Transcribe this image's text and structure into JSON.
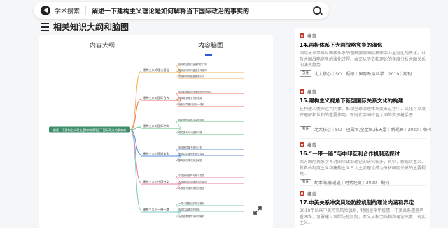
{
  "search": {
    "scope": "学术搜索",
    "query": "阐述一下建构主义理论是如何解释当下国际政治的事实的"
  },
  "section": {
    "title": "相关知识大纲和脑图"
  },
  "tabs": [
    {
      "label": "内容大纲"
    },
    {
      "label": "内容脑图"
    }
  ],
  "mindmap": {
    "root": "阐述一下建构主义理论是如何解释当下国际政治的事实的",
    "branches": [
      {
        "label": "建构主义的理论基础",
        "children": [
          "国际政治是社会建构的产物",
          "国家身份和利益由互动建构",
          "观念和规范塑造国家行为"
        ]
      },
      {
        "label": "建构主义对国际合作",
        "children": [
          "国际制度促进国家间合作的形成",
          "共享观念是合作的基础",
          "身份认同推动区域一体化"
        ]
      },
      {
        "label": "建构主义对国际冲突",
        "children": [
          "敌对身份导致冲突的持续",
          "观念变化可以缓和冲突"
        ]
      },
      {
        "label": "建构主义与国际安全",
        "children": [
          "安全困境源于相互认知",
          "安全共同体的形成与发展",
          "集体身份降低安全威胁"
        ]
      },
      {
        "label": "建构主义与中国外交",
        "children": [
          "中国身份建构与和平发展",
          "人类命运共同体理念的建构",
          "中国参与国际规范的塑造"
        ]
      },
      {
        "label": "建构主义与一带一路",
        "children": [
          "一带一路倡议的观念基础",
          "合作共赢理念的传播",
          "沿线国家身份认同的建构"
        ]
      }
    ]
  },
  "articles": [
    {
      "source": "维普",
      "title": "14.再极体系下大国战略竞争的演化",
      "abstract": "国际关系学界对两极体系的理解强调国际秩序中力量对比的变化，以及大国战略竞争的演化过程。本文从历史和理论的角度分析大国关系的演变趋势...",
      "tag": "引用",
      "meta": "北大核心｜SCI｜杨原｜国际政治科学｜2019｜期刊"
    },
    {
      "source": "维普",
      "title": "15.建构主义视角下新型国际关系文化的构建",
      "abstract": "在构建人类命运共同体、推动全球治理体系变革过程中，文化可以发挥理解和认知的重要作用。新时代中国特色大国外交多着手于...",
      "tag": "引用",
      "meta": "北大核心｜SCI｜巴殿君,全金姬,朱天雷｜新视野｜2020｜期刊"
    },
    {
      "source": "维普",
      "title": "16.“一带一路”与中印互利合作机制选探讨",
      "abstract": "西方国际关系学界对国际政治理论的研究较多，其中，新现实主义、新自由制度主义和建构主义三大主流理论成为分析国际关系的主要视角...",
      "tag": "引用",
      "meta": "胡本海,郭道道｜时代经贸｜2020｜期刊"
    },
    {
      "source": "维普",
      "title": "17.中美关系冲突风险防控机制的理论内涵和界定",
      "abstract": "2018年以来中美冲突风险加剧，特别是今年疫情、中美关系遭遇严重困难，急需建立风险防控机制。本文从权力结构和理论出发，现实主义...",
      "tag": "引用",
      "meta": "北大核心｜SCI｜杨学｜东北亚论坛｜2021｜期刊"
    }
  ],
  "colors": {
    "accent": "#2f5bd6",
    "root_node": "#3e8e6b",
    "badge": "#c0392b"
  }
}
